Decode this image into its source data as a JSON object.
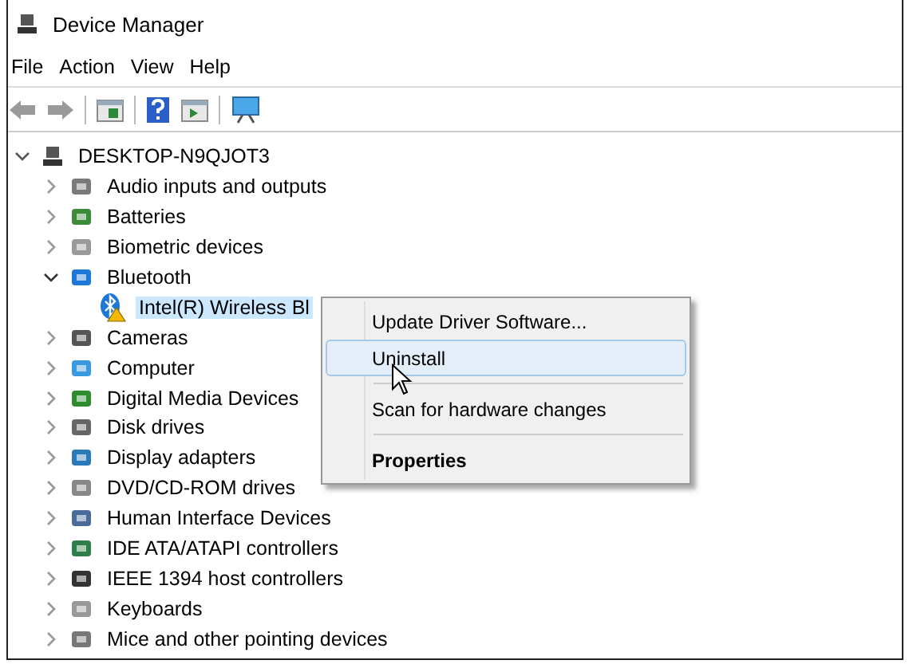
{
  "window": {
    "title": "Device Manager"
  },
  "menu_bar": [
    "File",
    "Action",
    "View",
    "Help"
  ],
  "tree": {
    "label": "DESKTOP-N9QJOT3",
    "expanded": true,
    "children": [
      {
        "label": "Audio inputs and outputs",
        "expanded": false
      },
      {
        "label": "Batteries",
        "expanded": false
      },
      {
        "label": "Biometric devices",
        "expanded": false
      },
      {
        "label": "Bluetooth",
        "expanded": true,
        "children": [
          {
            "label": "Intel(R) Wireless Bl",
            "selected": true,
            "warning": true
          }
        ]
      },
      {
        "label": "Cameras",
        "expanded": false
      },
      {
        "label": "Computer",
        "expanded": false
      },
      {
        "label": "Digital Media Devices",
        "expanded": false
      },
      {
        "label": "Disk drives",
        "expanded": false
      },
      {
        "label": "Display adapters",
        "expanded": false
      },
      {
        "label": "DVD/CD-ROM drives",
        "expanded": false
      },
      {
        "label": "Human Interface Devices",
        "expanded": false
      },
      {
        "label": "IDE ATA/ATAPI controllers",
        "expanded": false
      },
      {
        "label": "IEEE 1394 host controllers",
        "expanded": false
      },
      {
        "label": "Keyboards",
        "expanded": false
      },
      {
        "label": "Mice and other pointing devices",
        "expanded": false
      }
    ]
  },
  "context_menu": [
    {
      "kind": "item",
      "label": "Update Driver Software...",
      "selected": false
    },
    {
      "kind": "item",
      "label": "Uninstall",
      "selected": true
    },
    {
      "kind": "separator"
    },
    {
      "kind": "item",
      "label": "Scan for hardware changes",
      "selected": false
    },
    {
      "kind": "separator"
    },
    {
      "kind": "default",
      "label": "Properties",
      "selected": false
    }
  ]
}
